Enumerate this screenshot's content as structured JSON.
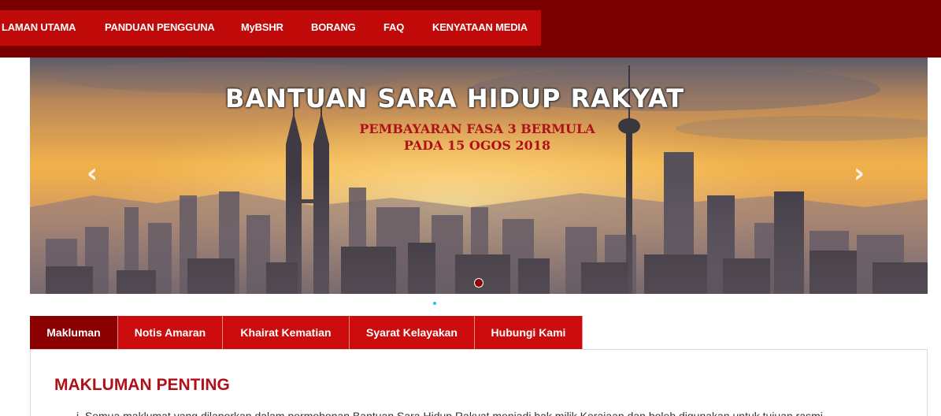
{
  "nav": {
    "items": [
      "LAMAN UTAMA",
      "PANDUAN PENGGUNA",
      "MyBSHR",
      "BORANG",
      "FAQ",
      "KENYATAAN MEDIA"
    ]
  },
  "banner": {
    "title": "BANTUAN SARA HIDUP RAKYAT",
    "subtitle_line1": "PEMBAYARAN FASA 3 BERMULA",
    "subtitle_line2": "PADA 15 OGOS 2018",
    "prev_icon": "‹",
    "next_icon": "›"
  },
  "tabs": [
    "Makluman",
    "Notis Amaran",
    "Khairat Kematian",
    "Syarat Kelayakan",
    "Hubungi Kami"
  ],
  "content": {
    "heading": "MAKLUMAN PENTING",
    "item1": "i. Semua maklumat yang dilaporkan dalam permohonan Bantuan Sara Hidup Rakyat menjadi hak milik Kerajaan dan boleh digunakan untuk tujuan rasmi"
  },
  "colors": {
    "topbar": "#7a0000",
    "nav": "#c00a0a",
    "tab": "#cc0c0c",
    "tab_active": "#8a0000",
    "heading": "#b0101a"
  }
}
